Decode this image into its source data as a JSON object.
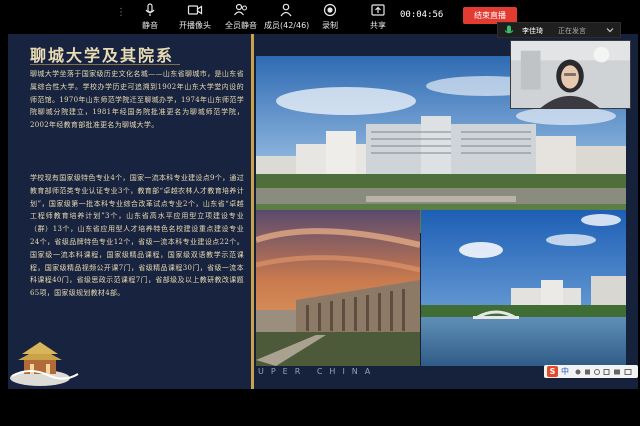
{
  "toolbar": {
    "mute_label": "静音",
    "video_label": "开播像头",
    "mute_all_label": "全员静音",
    "members_label": "成员(42/46)",
    "record_label": "录制",
    "share_label": "共享",
    "timer": "00:04:56",
    "end_label": "结束直播"
  },
  "speaker": {
    "name": "李佳琦",
    "status": "正在发言"
  },
  "slide": {
    "title": "聊城大学及其院系",
    "paragraph_1": "聊城大学坐落于国家级历史文化名城——山东省聊城市，是山东省属综合性大学。学校办学历史可追溯到1902年山东大学堂内设的师范馆。1970年山东师范学院迁至聊城办学，1974年山东师范学院聊城分院建立，1981年经国务院批准更名为聊城师范学院，2002年经教育部批准更名为聊城大学。",
    "paragraph_2": "学校现有国家级特色专业4个，国家一流本科专业建设点9个，通过教育部师范类专业认证专业3个，教育部“卓越农林人才教育培养计划”，国家级第一批本科专业综合改革试点专业2个，山东省“卓越工程师教育培养计划”3个，山东省高水平应用型立项建设专业（群）13个，山东省应用型人才培养特色名校建设重点建设专业24个，省级品牌特色专业12个，省级一流本科专业建设点22个。国家级一流本科课程，国家级精品课程，国家级双语教学示范课程，国家级精品视频公开课7门，省级精品课程30门，省级一流本科课程40门，省级思政示范课程7门，省部级及以上教研教改课题65项，国家级规划教材4部。",
    "motto": "UPER CHINA"
  },
  "ime": {
    "logo": "S",
    "lang": "中"
  },
  "colors": {
    "slide_bg": "#16213c",
    "gold": "#c9a24a",
    "text": "#e9dcb3",
    "end_button": "#e23b32"
  }
}
